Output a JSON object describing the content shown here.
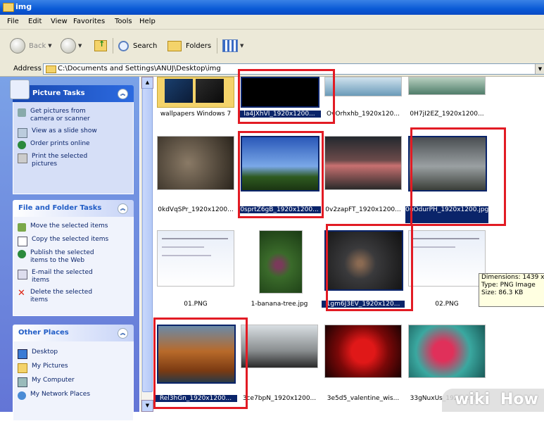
{
  "window": {
    "title": "img"
  },
  "menu": [
    "File",
    "Edit",
    "View",
    "Favorites",
    "Tools",
    "Help"
  ],
  "toolbar": {
    "back": "Back",
    "search": "Search",
    "folders": "Folders"
  },
  "address": {
    "label": "Address",
    "path": "C:\\Documents and Settings\\ANUJ\\Desktop\\img"
  },
  "taskpane": {
    "picture_tasks": {
      "title": "Picture Tasks",
      "items": [
        {
          "label": "Get pictures from\ncamera or scanner",
          "icon": "camera-icon"
        },
        {
          "label": "View as a slide show",
          "icon": "slideshow-icon"
        },
        {
          "label": "Order prints online",
          "icon": "globe-icon"
        },
        {
          "label": "Print the selected\npictures",
          "icon": "printer-icon"
        }
      ]
    },
    "file_tasks": {
      "title": "File and Folder Tasks",
      "items": [
        {
          "label": "Move the selected items",
          "icon": "move-icon"
        },
        {
          "label": "Copy the selected items",
          "icon": "copy-icon"
        },
        {
          "label": "Publish the selected\nitems to the Web",
          "icon": "publish-icon"
        },
        {
          "label": "E-mail the selected\nitems",
          "icon": "email-icon"
        },
        {
          "label": "Delete the selected\nitems",
          "icon": "delete-icon"
        }
      ]
    },
    "other_places": {
      "title": "Other Places",
      "items": [
        {
          "label": "Desktop",
          "icon": "desktop-icon"
        },
        {
          "label": "My Pictures",
          "icon": "pictures-folder-icon"
        },
        {
          "label": "My Computer",
          "icon": "computer-icon"
        },
        {
          "label": "My Network Places",
          "icon": "network-icon"
        }
      ]
    }
  },
  "files": [
    {
      "name": "wallpapers Windows 7",
      "selected": false,
      "highlighted": false
    },
    {
      "name": "la4JXhVI_1920x1200...",
      "selected": true,
      "highlighted": true
    },
    {
      "name": "OvOrhxhb_1920x120...",
      "selected": false,
      "highlighted": false
    },
    {
      "name": "0H7jI2EZ_1920x1200...",
      "selected": false,
      "highlighted": false
    },
    {
      "name": "0kdVqSPr_1920x1200...",
      "selected": false,
      "highlighted": false
    },
    {
      "name": "0sprtZ6gB_1920x1200...",
      "selected": true,
      "highlighted": true
    },
    {
      "name": "0v2zapFT_1920x1200...",
      "selected": false,
      "highlighted": false
    },
    {
      "name": "0uOdurPH_1920x1200.jpg",
      "selected": true,
      "highlighted": true
    },
    {
      "name": "01.PNG",
      "selected": false,
      "highlighted": false
    },
    {
      "name": "1-banana-tree.jpg",
      "selected": false,
      "highlighted": false
    },
    {
      "name": "1gm6J3EV_1920x120...",
      "selected": true,
      "highlighted": true
    },
    {
      "name": "02.PNG",
      "selected": false,
      "highlighted": false
    },
    {
      "name": "Rel3hGn_1920x1200...",
      "selected": true,
      "highlighted": true
    },
    {
      "name": "3ce7bpN_1920x1200...",
      "selected": false,
      "highlighted": false
    },
    {
      "name": "3e5d5_valentine_wis...",
      "selected": false,
      "highlighted": false
    },
    {
      "name": "33gNuxUs_1920x120...",
      "selected": false,
      "highlighted": false
    }
  ],
  "tooltip": {
    "lines": [
      "Dimensions: 1439 x",
      "Type: PNG Image",
      "Size: 86.3 KB"
    ]
  },
  "watermark": {
    "a": "wiki",
    "b": "How"
  },
  "colors": {
    "selection": "#0a246a",
    "highlight": "#e21b24",
    "taskpane": "#7ba2e7"
  }
}
